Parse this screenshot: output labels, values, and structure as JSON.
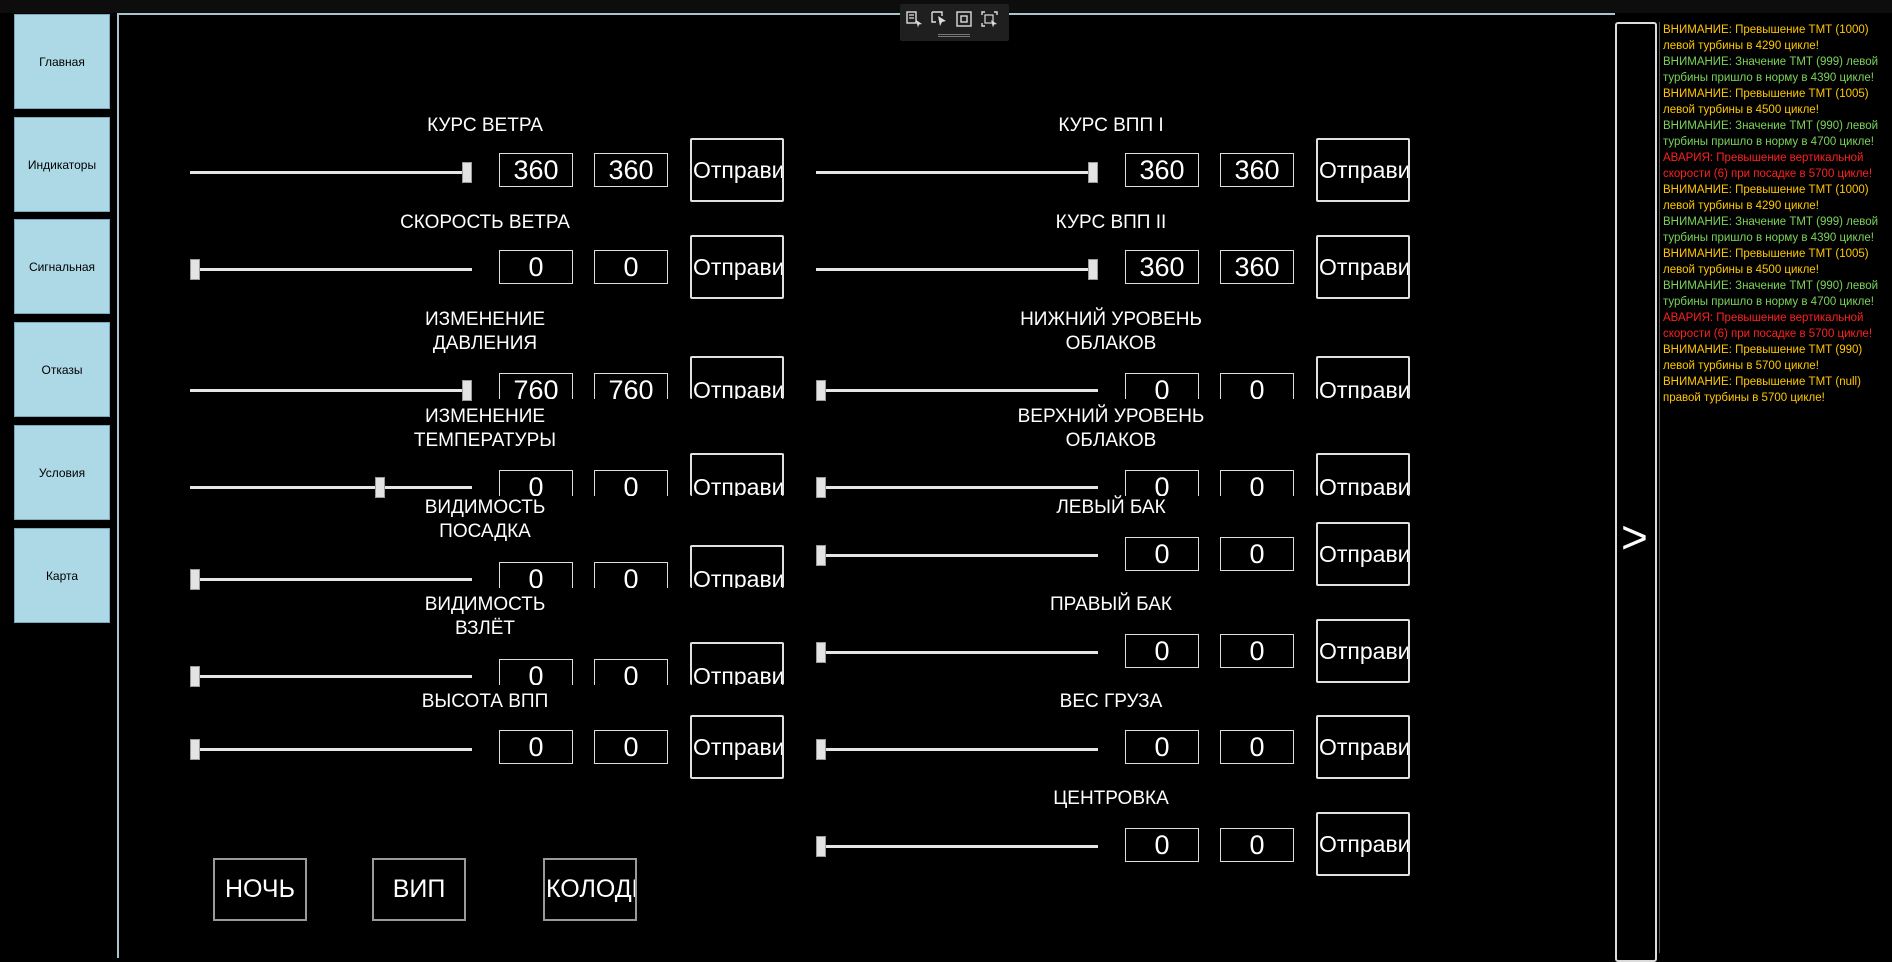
{
  "nav": [
    {
      "label": "Главная"
    },
    {
      "label": "Индикаторы"
    },
    {
      "label": "Сигнальная"
    },
    {
      "label": "Отказы"
    },
    {
      "label": "Условия"
    },
    {
      "label": "Карта"
    }
  ],
  "send_label": "Отправить",
  "controls_left": [
    {
      "label": "КУРС ВЕТРА",
      "value": "360",
      "value2": "360",
      "slider": 1.0
    },
    {
      "label": "СКОРОСТЬ ВЕТРА",
      "value": "0",
      "value2": "0",
      "slider": 0.0
    },
    {
      "label": "ИЗМЕНЕНИЕ\nДАВЛЕНИЯ",
      "value": "760",
      "value2": "760",
      "slider": 1.0
    },
    {
      "label": "ИЗМЕНЕНИЕ\nТЕМПЕРАТУРЫ",
      "value": "0",
      "value2": "0",
      "slider": 0.68
    },
    {
      "label": "ВИДИМОСТЬ\nПОСАДКА",
      "value": "0",
      "value2": "0",
      "slider": 0.0
    },
    {
      "label": "ВИДИМОСТЬ\nВЗЛЁТ",
      "value": "0",
      "value2": "0",
      "slider": 0.0
    },
    {
      "label": "ВЫСОТА ВПП",
      "value": "0",
      "value2": "0",
      "slider": 0.0
    }
  ],
  "controls_right": [
    {
      "label": "КУРС ВПП I",
      "value": "360",
      "value2": "360",
      "slider": 1.0
    },
    {
      "label": "КУРС ВПП II",
      "value": "360",
      "value2": "360",
      "slider": 1.0
    },
    {
      "label": "НИЖНИЙ УРОВЕНЬ\nОБЛАКОВ",
      "value": "0",
      "value2": "0",
      "slider": 0.0
    },
    {
      "label": "ВЕРХНИЙ УРОВЕНЬ\nОБЛАКОВ",
      "value": "0",
      "value2": "0",
      "slider": 0.0
    },
    {
      "label": "ЛЕВЫЙ БАК",
      "value": "0",
      "value2": "0",
      "slider": 0.0
    },
    {
      "label": "ПРАВЫЙ БАК",
      "value": "0",
      "value2": "0",
      "slider": 0.0
    },
    {
      "label": "ВЕС ГРУЗА",
      "value": "0",
      "value2": "0",
      "slider": 0.0
    },
    {
      "label": "ЦЕНТРОВКА",
      "value": "0",
      "value2": "0",
      "slider": 0.0
    }
  ],
  "bottom_buttons": [
    {
      "label": "НОЧЬ"
    },
    {
      "label": "ВИП"
    },
    {
      "label": "КОЛОДКИ"
    }
  ],
  "collapse_label": ">",
  "colors": {
    "warning": "#ffc800",
    "normal": "#7bd45a",
    "alarm": "#ff2020",
    "nav_bg": "#add8e6"
  },
  "log": [
    {
      "level": "warning",
      "text": "ВНИМАНИЕ: Превышение ТМТ (1000) левой турбины в 4290 цикле!"
    },
    {
      "level": "normal",
      "text": "ВНИМАНИЕ: Значение ТМТ (999) левой турбины пришло в норму в 4390 цикле!"
    },
    {
      "level": "warning",
      "text": "ВНИМАНИЕ: Превышение ТМТ (1005) левой турбины в 4500 цикле!"
    },
    {
      "level": "normal",
      "text": "ВНИМАНИЕ: Значение ТМТ (990) левой турбины пришло в норму в 4700 цикле!"
    },
    {
      "level": "alarm",
      "text": "АВАРИЯ: Превышение вертикальной скорости (6) при посадке в 5700 цикле!"
    },
    {
      "level": "warning",
      "text": "ВНИМАНИЕ: Превышение ТМТ (1000) левой турбины в 4290 цикле!"
    },
    {
      "level": "normal",
      "text": "ВНИМАНИЕ: Значение ТМТ (999) левой турбины пришло в норму в 4390 цикле!"
    },
    {
      "level": "warning",
      "text": "ВНИМАНИЕ: Превышение ТМТ (1005) левой турбины в 4500 цикле!"
    },
    {
      "level": "normal",
      "text": "ВНИМАНИЕ: Значение ТМТ (990) левой турбины пришло в норму в 4700 цикле!"
    },
    {
      "level": "alarm",
      "text": "АВАРИЯ: Превышение вертикальной скорости (6) при посадке в 5700 цикле!"
    },
    {
      "level": "warning",
      "text": "ВНИМАНИЕ: Превышение ТМТ (990) левой турбины в 5700 цикле!"
    },
    {
      "level": "warning",
      "text": "ВНИМАНИЕ: Превышение ТМТ (null) правой турбины в 5700 цикле!"
    }
  ],
  "toolbar_icons": [
    "live-tree-icon",
    "select-element-icon",
    "display-layout-adorners-icon",
    "track-focused-element-icon"
  ]
}
